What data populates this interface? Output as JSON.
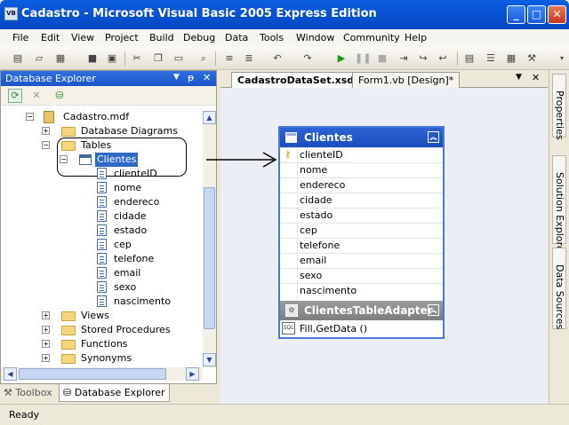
{
  "window": {
    "title": "Cadastro - Microsoft Visual Basic 2005 Express Edition",
    "icon": "VB"
  },
  "menu": [
    "File",
    "Edit",
    "View",
    "Project",
    "Build",
    "Debug",
    "Data",
    "Tools",
    "Window",
    "Community",
    "Help"
  ],
  "database_explorer": {
    "title": "Database Explorer",
    "pin": "ᵽ",
    "close": "✕"
  },
  "tree": {
    "root": "Cadastro.mdf",
    "diagrams": "Database Diagrams",
    "tables": "Tables",
    "clientes": "Clientes",
    "columns": [
      "clienteID",
      "nome",
      "endereco",
      "cidade",
      "estado",
      "cep",
      "telefone",
      "email",
      "sexo",
      "nascimento"
    ],
    "views": "Views",
    "procedures": "Stored Procedures",
    "functions": "Functions",
    "synonyms": "Synonyms"
  },
  "bottom_tabs": {
    "toolbox": "Toolbox",
    "db_explorer": "Database Explorer"
  },
  "doc_tabs": {
    "active": "CadastroDataSet.xsd*",
    "other": "Form1.vb [Design]*",
    "close": "✕"
  },
  "designer": {
    "table_title": "Clientes",
    "columns": [
      "clienteID",
      "nome",
      "endereco",
      "cidade",
      "estado",
      "cep",
      "telefone",
      "email",
      "sexo",
      "nascimento"
    ],
    "adapter_title": "ClientesTableAdapter",
    "query": "Fill,GetData ()",
    "sql_icon": "SQL"
  },
  "right_strip": {
    "properties": "Properties",
    "solution_explorer": "Solution Explorer",
    "data_sources": "Data Sources"
  },
  "status": {
    "text": "Ready"
  }
}
